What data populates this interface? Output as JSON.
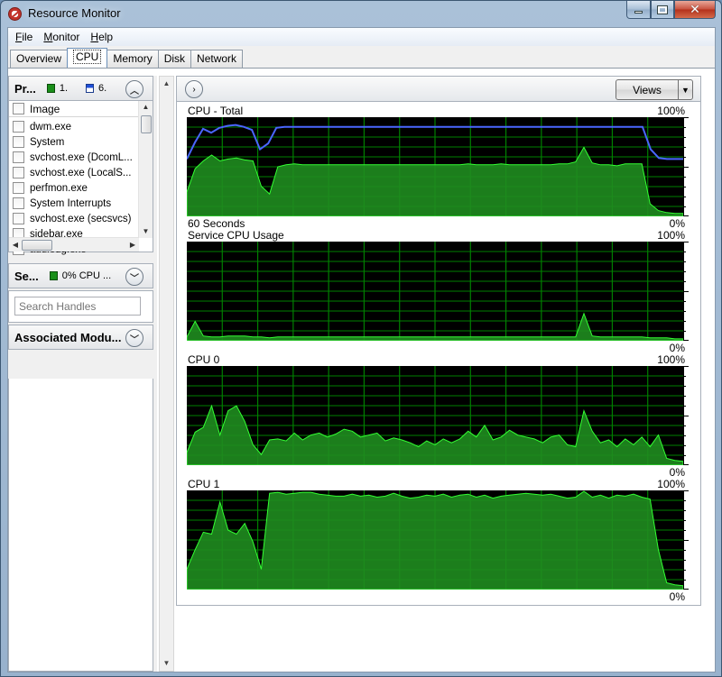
{
  "window": {
    "title": "Resource Monitor",
    "caption": {
      "close": "✕"
    }
  },
  "menu": [
    {
      "label": "File"
    },
    {
      "label": "Monitor"
    },
    {
      "label": "Help"
    }
  ],
  "tabs": [
    {
      "label": "Overview",
      "active": false
    },
    {
      "label": "CPU",
      "active": true
    },
    {
      "label": "Memory",
      "active": false
    },
    {
      "label": "Disk",
      "active": false
    },
    {
      "label": "Network",
      "active": false
    }
  ],
  "left": {
    "processes": {
      "title": "Pr...",
      "stat1": "1.",
      "stat2": "6.",
      "column": "Image",
      "rows": [
        "dwm.exe",
        "System",
        "svchost.exe (DcomL...",
        "svchost.exe (LocalS...",
        "perfmon.exe",
        "System Interrupts",
        "svchost.exe (secsvcs)",
        "sidebar.exe",
        "audiodg.exe"
      ]
    },
    "services": {
      "title": "Se...",
      "stat": "0% CPU ..."
    },
    "handles": {
      "placeholder": "Search Handles"
    },
    "modules": {
      "title": "Associated Modu..."
    }
  },
  "right": {
    "views_label": "Views",
    "graphs": [
      {
        "title": "CPU - Total",
        "max": "100%",
        "footer_left": "60 Seconds",
        "footer_right": "0%",
        "values": [
          24,
          48,
          56,
          62,
          56,
          58,
          59,
          57,
          56,
          30,
          22,
          50,
          52,
          53,
          52,
          52,
          52,
          52,
          52,
          52,
          52,
          52,
          52,
          52,
          52,
          52,
          52,
          52,
          52,
          52,
          52,
          52,
          52,
          52,
          53,
          52,
          52,
          52,
          53,
          52,
          52,
          52,
          52,
          52,
          52,
          53,
          53,
          55,
          70,
          54,
          52,
          52,
          51,
          53,
          53,
          53,
          12,
          5,
          3,
          2,
          2
        ],
        "line": [
          58,
          75,
          89,
          85,
          90,
          92,
          93,
          91,
          88,
          68,
          74,
          90,
          91,
          91,
          91,
          91,
          91,
          91,
          91,
          91,
          91,
          91,
          91,
          91,
          91,
          91,
          91,
          91,
          91,
          91,
          91,
          91,
          91,
          91,
          91,
          91,
          91,
          91,
          91,
          91,
          91,
          91,
          91,
          91,
          91,
          91,
          91,
          91,
          91,
          91,
          91,
          91,
          91,
          91,
          91,
          91,
          91,
          68,
          59,
          58,
          58,
          58
        ]
      },
      {
        "title": "Service CPU Usage",
        "max": "100%",
        "footer_left": "",
        "footer_right": "0%",
        "values": [
          3,
          19,
          4,
          3,
          3,
          4,
          4,
          4,
          3,
          3,
          2,
          3,
          3,
          3,
          3,
          3,
          3,
          3,
          3,
          3,
          3,
          3,
          3,
          3,
          3,
          3,
          3,
          3,
          3,
          3,
          3,
          3,
          3,
          3,
          3,
          3,
          3,
          3,
          3,
          3,
          3,
          3,
          3,
          3,
          3,
          3,
          3,
          3,
          27,
          4,
          3,
          3,
          3,
          3,
          3,
          3,
          2,
          2,
          2,
          1,
          1
        ]
      },
      {
        "title": "CPU 0",
        "max": "100%",
        "footer_left": "",
        "footer_right": "0%",
        "values": [
          12,
          33,
          38,
          60,
          30,
          55,
          60,
          44,
          20,
          10,
          25,
          26,
          24,
          32,
          25,
          30,
          32,
          28,
          31,
          36,
          34,
          28,
          30,
          32,
          24,
          27,
          25,
          22,
          18,
          24,
          20,
          26,
          22,
          26,
          34,
          28,
          40,
          25,
          28,
          35,
          30,
          28,
          26,
          22,
          28,
          30,
          20,
          18,
          55,
          34,
          22,
          25,
          18,
          26,
          20,
          28,
          18,
          30,
          6,
          4,
          3
        ]
      },
      {
        "title": "CPU 1",
        "max": "100%",
        "footer_left": "",
        "footer_right": "0%",
        "values": [
          20,
          40,
          58,
          56,
          89,
          60,
          56,
          67,
          48,
          20,
          98,
          99,
          97,
          98,
          99,
          99,
          97,
          96,
          95,
          95,
          97,
          95,
          96,
          94,
          95,
          98,
          95,
          93,
          94,
          96,
          95,
          97,
          94,
          96,
          97,
          94,
          96,
          93,
          95,
          96,
          97,
          98,
          97,
          96,
          97,
          95,
          93,
          94,
          100,
          94,
          96,
          93,
          96,
          95,
          97,
          94,
          92,
          40,
          6,
          4,
          3
        ]
      }
    ]
  },
  "colors": {
    "graph_bg": "#000000",
    "grid": "#008000",
    "fill": "#1f8c1f",
    "stroke": "#33ff33",
    "cpu_line": "#4a66ff"
  }
}
